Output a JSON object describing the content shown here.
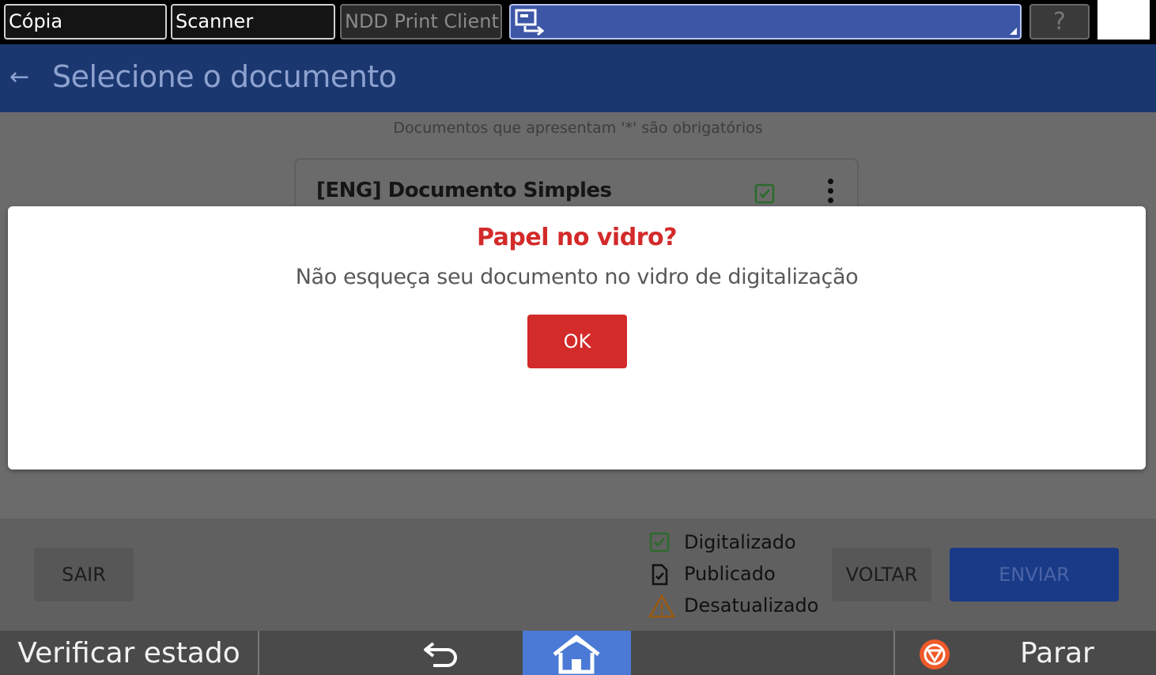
{
  "top_tabs": [
    {
      "label": "Cópia",
      "state": "normal"
    },
    {
      "label": "Scanner",
      "state": "normal"
    },
    {
      "label": "NDD Print Client",
      "state": "disabled"
    },
    {
      "label": "",
      "state": "current",
      "icon": "scan-app-icon"
    }
  ],
  "top_right": {
    "help_label": "?",
    "sleep_icon": "moon-icon"
  },
  "header": {
    "back_icon": "back-arrow-icon",
    "title": "Selecione o documento"
  },
  "content": {
    "required_note": "Documentos que apresentam '*' são obrigatórios",
    "documents": [
      {
        "name": "[ENG] Documento Simples",
        "status_icon": "digitized-check-icon"
      }
    ]
  },
  "dialog": {
    "title": "Papel no vidro?",
    "message": "Não esqueça seu documento no vidro de digitalização",
    "ok_label": "OK"
  },
  "actions": {
    "exit_label": "SAIR",
    "back_label": "VOLTAR",
    "send_label": "ENVIAR"
  },
  "legend": [
    {
      "icon": "digitized-check-icon",
      "label": "Digitalizado"
    },
    {
      "icon": "published-document-icon",
      "label": "Publicado"
    },
    {
      "icon": "outdated-warning-icon",
      "label": "Desatualizado"
    }
  ],
  "system_bar": {
    "check_status_label": "Verificar estado",
    "stop_label": "Parar"
  },
  "colors": {
    "header_blue": "#1a3770",
    "accent_red": "#d32a2a",
    "home_blue": "#4a7ad6",
    "check_green": "#3a8a3a",
    "warning_orange": "#c77a1a"
  }
}
